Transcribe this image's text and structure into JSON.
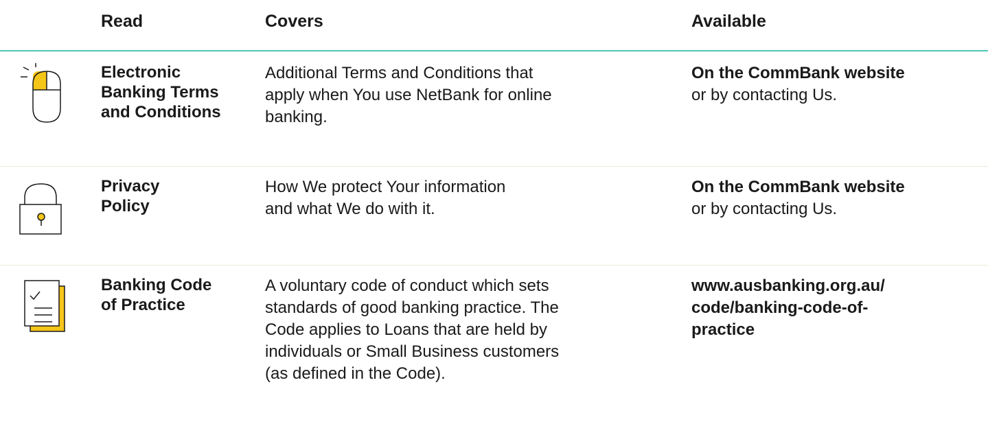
{
  "header": {
    "read": "Read",
    "covers": "Covers",
    "available": "Available"
  },
  "rows": [
    {
      "icon": "mouse-click-icon",
      "title_lines": [
        "Electronic",
        "Banking Terms",
        "and Conditions"
      ],
      "covers_lines": [
        "Additional Terms and Conditions that",
        "apply when You use NetBank for online",
        "banking."
      ],
      "available_lines": [
        "On the CommBank website",
        "or by contacting Us."
      ]
    },
    {
      "icon": "padlock-icon",
      "title_lines": [
        "Privacy",
        "Policy"
      ],
      "covers_lines": [
        "How We protect Your information",
        "and what We do with it."
      ],
      "available_lines": [
        "On the CommBank website",
        "or by contacting Us."
      ]
    },
    {
      "icon": "document-checklist-icon",
      "title_lines": [
        "Banking Code",
        "of Practice"
      ],
      "covers_lines": [
        "A voluntary code of conduct which sets",
        "standards of good banking practice. The",
        "Code applies to Loans that are held by",
        "individuals or Small Business customers",
        "(as defined in the Code)."
      ],
      "available_lines": [
        "www.ausbanking.org.au/",
        "code/banking-code-of-",
        "practice"
      ]
    }
  ],
  "colors": {
    "accent_rule": "#4fc6b4",
    "icon_yellow": "#f5c518",
    "separator": "#ece8d6"
  }
}
